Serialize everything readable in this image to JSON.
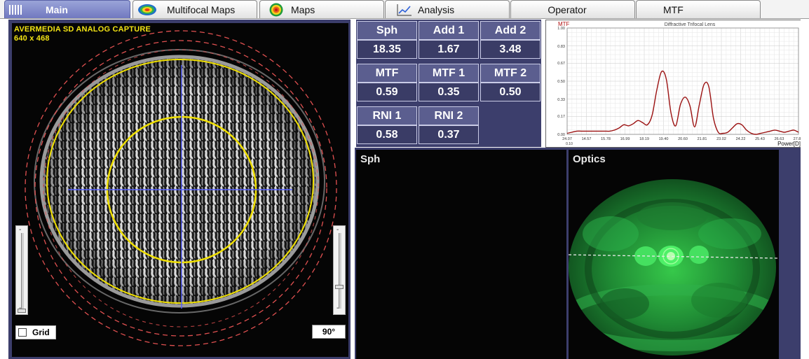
{
  "tabs": [
    {
      "label": "Main",
      "icon": "barcode-icon",
      "active": true
    },
    {
      "label": "Multifocal Maps",
      "icon": "multifocal-map-icon"
    },
    {
      "label": "Maps",
      "icon": "target-map-icon"
    },
    {
      "label": "Analysis",
      "icon": "chart-analysis-icon"
    },
    {
      "label": "Operator"
    },
    {
      "label": "MTF"
    }
  ],
  "capture": {
    "device": "AVERMEDIA SD ANALOG CAPTURE",
    "resolution": "640 x 468"
  },
  "controls": {
    "grid_label": "Grid",
    "grid_checked": false,
    "angle": "90°",
    "slider_minus": "-"
  },
  "stats": {
    "row1": [
      {
        "label": "Sph",
        "value": "18.35"
      },
      {
        "label": "Add 1",
        "value": "1.67"
      },
      {
        "label": "Add 2",
        "value": "3.48"
      }
    ],
    "row2": [
      {
        "label": "MTF",
        "value": "0.59"
      },
      {
        "label": "MTF 1",
        "value": "0.35"
      },
      {
        "label": "MTF 2",
        "value": "0.50"
      }
    ],
    "row3": [
      {
        "label": "RNI 1",
        "value": "0.58"
      },
      {
        "label": "RNI 2",
        "value": "0.37"
      }
    ]
  },
  "panels": {
    "sph_title": "Sph",
    "optics_title": "Optics"
  },
  "colors": {
    "panel_bg": "#3c3e6c",
    "header_cell": "#5b5e8f",
    "value_cell": "#3a3c66",
    "crosshair": "#5560ff",
    "zone_circle": "#f0e000",
    "dashed_ring": "#e05050",
    "mtf_line": "#9b1111",
    "optics_green": "#22c240"
  },
  "chart_data": {
    "type": "line",
    "title": "Diffractive Trifocal Lens",
    "ylabel": "MTF",
    "xlabel": "Power[D]",
    "xlim": [
      24.07,
      27.8
    ],
    "ylim": [
      0.0,
      1.0
    ],
    "x_ticks": [
      "24.07",
      "14.57",
      "15.78",
      "16.99",
      "18.19",
      "19.40",
      "20.60",
      "21.81",
      "23.02",
      "24.22",
      "25.43",
      "26.63",
      "27.8"
    ],
    "x_tick_extra": "0.10",
    "y_ticks": [
      "1.00",
      "0.83",
      "0.67",
      "0.50",
      "0.33",
      "0.17",
      "0.00"
    ],
    "grid": true,
    "series": [
      {
        "values": [
          0.01,
          0.02,
          0.03,
          0.03,
          0.03,
          0.03,
          0.03,
          0.03,
          0.03,
          0.03,
          0.04,
          0.06,
          0.09,
          0.08,
          0.1,
          0.13,
          0.11,
          0.09,
          0.18,
          0.42,
          0.59,
          0.52,
          0.2,
          0.08,
          0.28,
          0.35,
          0.27,
          0.07,
          0.28,
          0.47,
          0.45,
          0.15,
          0.02,
          0.01,
          0.02,
          0.06,
          0.1,
          0.09,
          0.04,
          0.01,
          0.0,
          0.01,
          0.02,
          0.03,
          0.04,
          0.03,
          0.02,
          0.03,
          0.04,
          0.02
        ]
      }
    ]
  }
}
